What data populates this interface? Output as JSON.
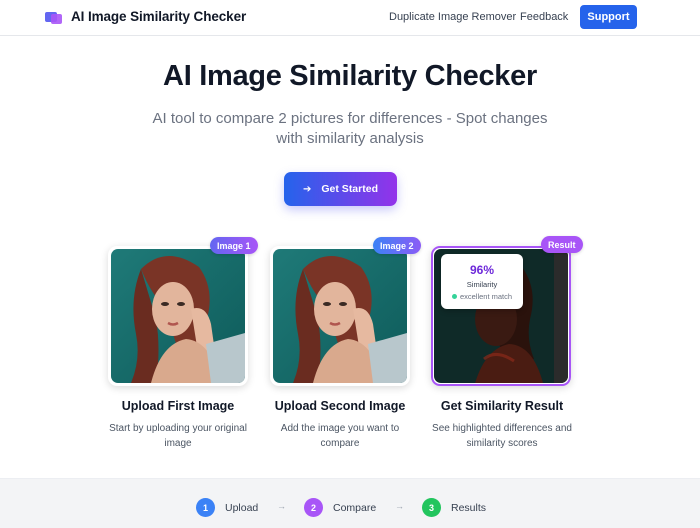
{
  "header": {
    "brand": "AI Image Similarity Checker",
    "nav": [
      "Duplicate Image Remover",
      "Feedback"
    ],
    "support_label": "Support"
  },
  "hero": {
    "title": "AI Image Similarity Checker",
    "subtitle": "AI tool to compare 2 pictures for differences - Spot changes with similarity analysis",
    "cta_label": "Get Started"
  },
  "cards": [
    {
      "badge": "Image 1",
      "title": "Upload First Image",
      "desc": "Start by uploading your original image"
    },
    {
      "badge": "Image 2",
      "title": "Upload Second Image",
      "desc": "Add the image you want to compare"
    },
    {
      "badge": "Result",
      "title": "Get Similarity Result",
      "desc": "See highlighted differences and similarity scores"
    }
  ],
  "result": {
    "value": "96%",
    "label": "Similarity",
    "match": "excellent match"
  },
  "progress": [
    {
      "num": "1",
      "label": "Upload"
    },
    {
      "num": "2",
      "label": "Compare"
    },
    {
      "num": "3",
      "label": "Results"
    }
  ],
  "colors": {
    "primary": "#2563eb",
    "accent": "#a855f7",
    "success": "#22c55e"
  }
}
